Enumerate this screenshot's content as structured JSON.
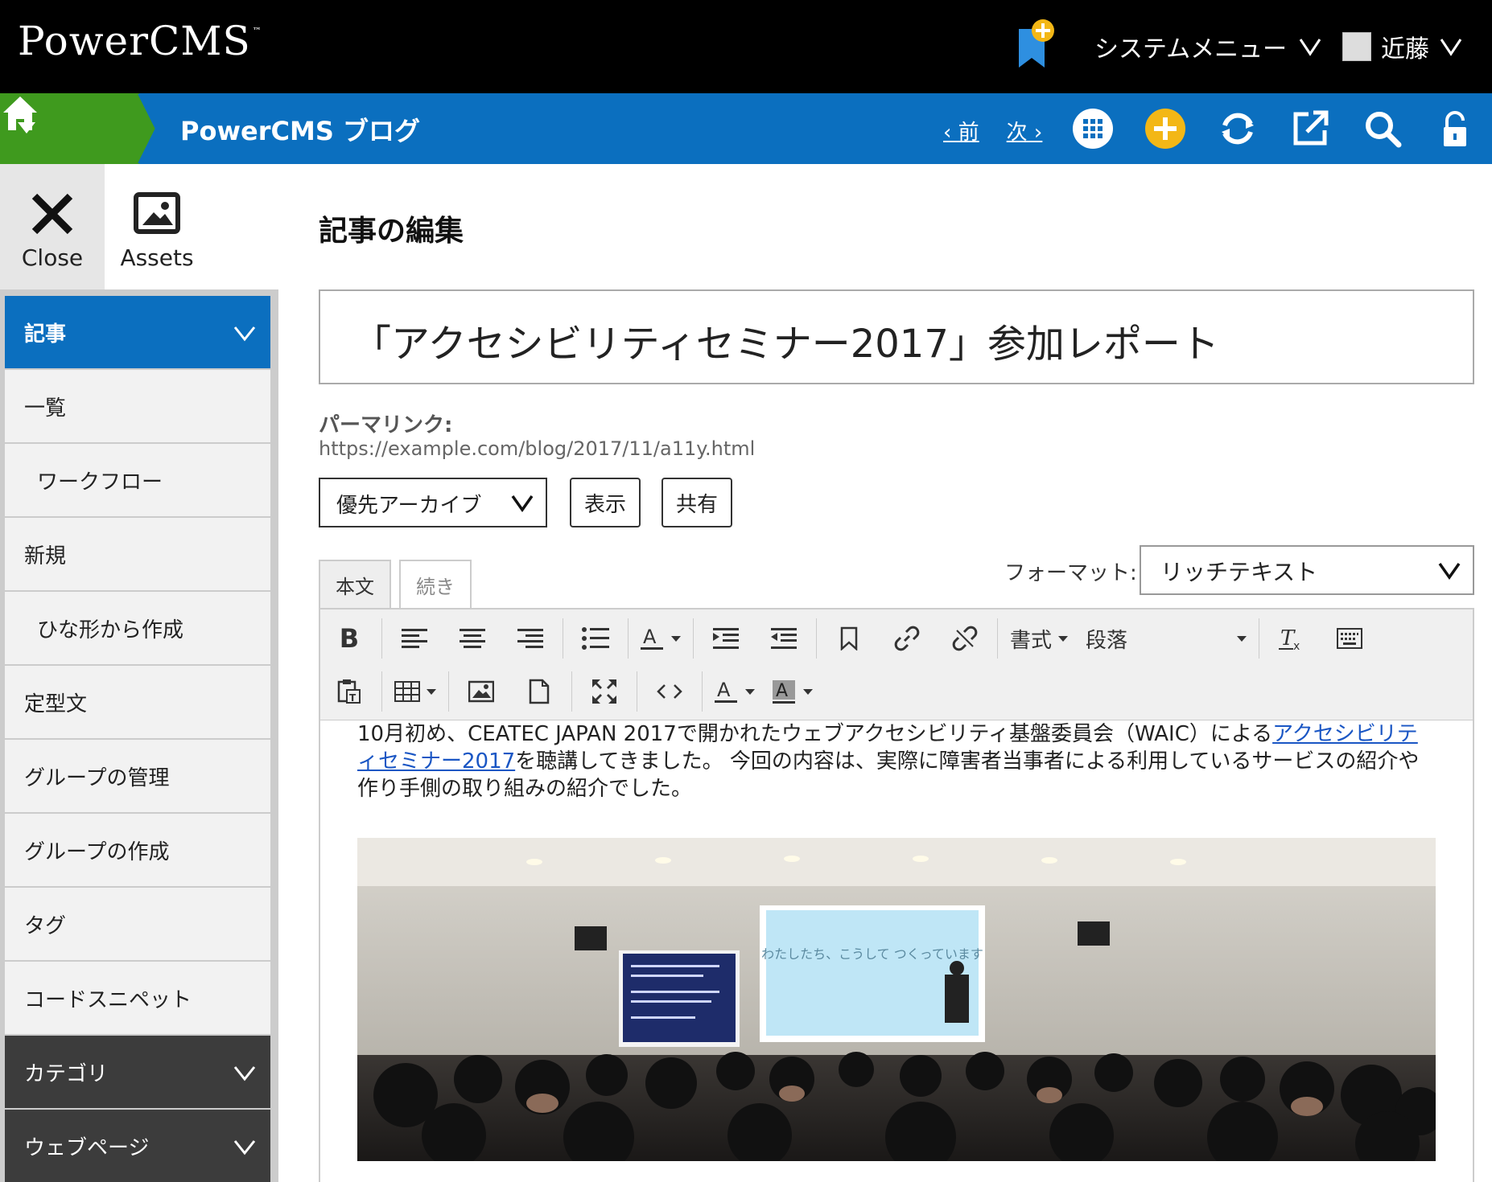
{
  "header": {
    "logo": "PowerCMS",
    "logo_tm": "™",
    "system_menu": "システムメニュー",
    "user_name": "近藤"
  },
  "nav": {
    "blog_title": "PowerCMS ブログ",
    "prev": "‹ 前",
    "next": "次 ›"
  },
  "tools": {
    "close": "Close",
    "assets": "Assets"
  },
  "sidebar": {
    "items": [
      {
        "label": "記事"
      },
      {
        "label": "一覧"
      },
      {
        "label": "ワークフロー"
      },
      {
        "label": "新規"
      },
      {
        "label": "ひな形から作成"
      },
      {
        "label": "定型文"
      },
      {
        "label": "グループの管理"
      },
      {
        "label": "グループの作成"
      },
      {
        "label": "タグ"
      },
      {
        "label": "コードスニペット"
      },
      {
        "label": "カテゴリ"
      },
      {
        "label": "ウェブページ"
      }
    ]
  },
  "main": {
    "heading": "記事の編集",
    "title_value": "「アクセシビリティセミナー2017」参加レポート",
    "permalink_label": "パーマリンク:",
    "permalink_url": "https://example.com/blog/2017/11/a11y.html",
    "archive_select": "優先アーカイブ",
    "view_button": "表示",
    "share_button": "共有",
    "tab_body": "本文",
    "tab_more": "続き",
    "format_label": "フォーマット:",
    "format_value": "リッチテキスト"
  },
  "toolbar": {
    "bold": "B",
    "format_menu": "書式",
    "block_select": "段落"
  },
  "content": {
    "text_before": "10月初め、CEATEC JAPAN 2017で開かれたウェブアクセシビリティ基盤委員会（WAIC）による",
    "link_text": "アクセシビリティセミナー2017",
    "text_after": "を聴講してきました。 今回の内容は、実際に障害者当事者による利用しているサービスの紹介や作り手側の取り組みの紹介でした。",
    "photo_slide_text": "わたしたち、こうして つくっています"
  },
  "colors": {
    "header_bg": "#000000",
    "nav_blue": "#0b6fbf",
    "nav_green": "#3f9a1e",
    "accent_yellow": "#f3b716",
    "sidebar_dark": "#3c3c3c"
  }
}
